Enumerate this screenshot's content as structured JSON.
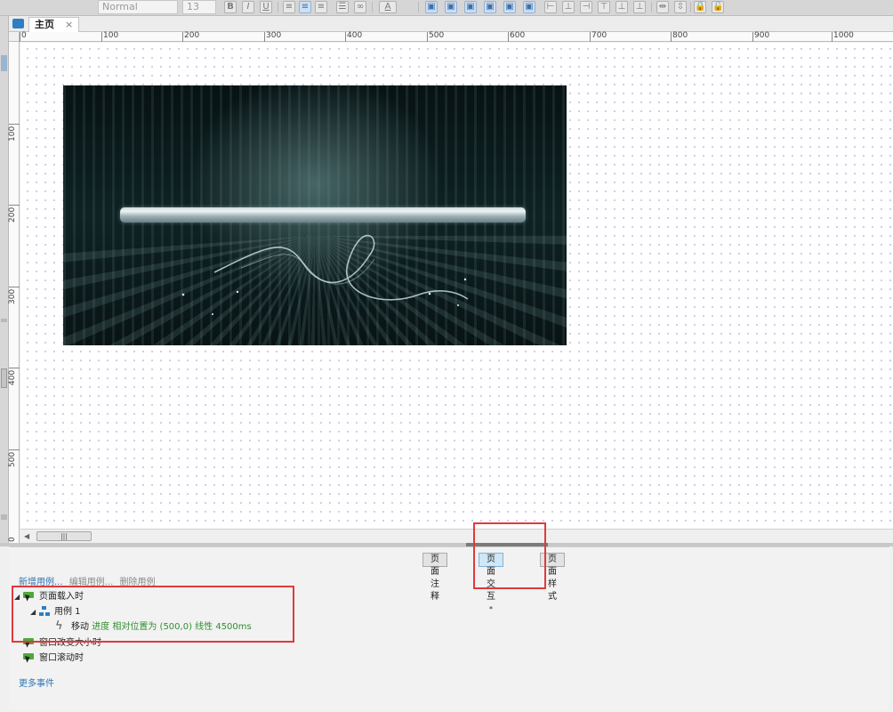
{
  "toolbar": {
    "font_style_value": "Normal",
    "font_size_value": "13",
    "bold_label": "B",
    "italic_label": "I",
    "underline_label": "U",
    "text_color_label": "A"
  },
  "tabs": {
    "home_tab_label": "主页",
    "close_glyph": "×"
  },
  "rulers": {
    "horizontal_labels": [
      "0",
      "100",
      "200",
      "300",
      "400",
      "500",
      "600",
      "700",
      "800",
      "900",
      "1000"
    ],
    "vertical_labels": [
      "100",
      "200",
      "300",
      "400",
      "500",
      "0"
    ]
  },
  "scrollbar": {
    "arrow_left": "◀",
    "thumb_grip": "|||"
  },
  "panel": {
    "tabs": [
      "页面注释",
      "页面交互",
      "页面样式"
    ],
    "active_tab_star": "*",
    "actions": {
      "add_case": "新增用例...",
      "edit_case": "编辑用例...",
      "delete_case": "删除用例"
    },
    "tree": {
      "event_page_load": "页面载入时",
      "case_1": "用例 1",
      "action_move": "移动",
      "action_detail": "进度 相对位置为 (500,0) 线性 4500ms",
      "event_window_resize": "窗口改变大小时",
      "event_window_scroll": "窗口滚动时"
    },
    "more_events": "更多事件"
  },
  "colors": {
    "annotation_red": "#e03a3a",
    "link_blue": "#2e74b5",
    "event_green": "#4fa83b",
    "detail_green": "#2f8f2f",
    "active_tab_bg": "#cfe7f7"
  }
}
